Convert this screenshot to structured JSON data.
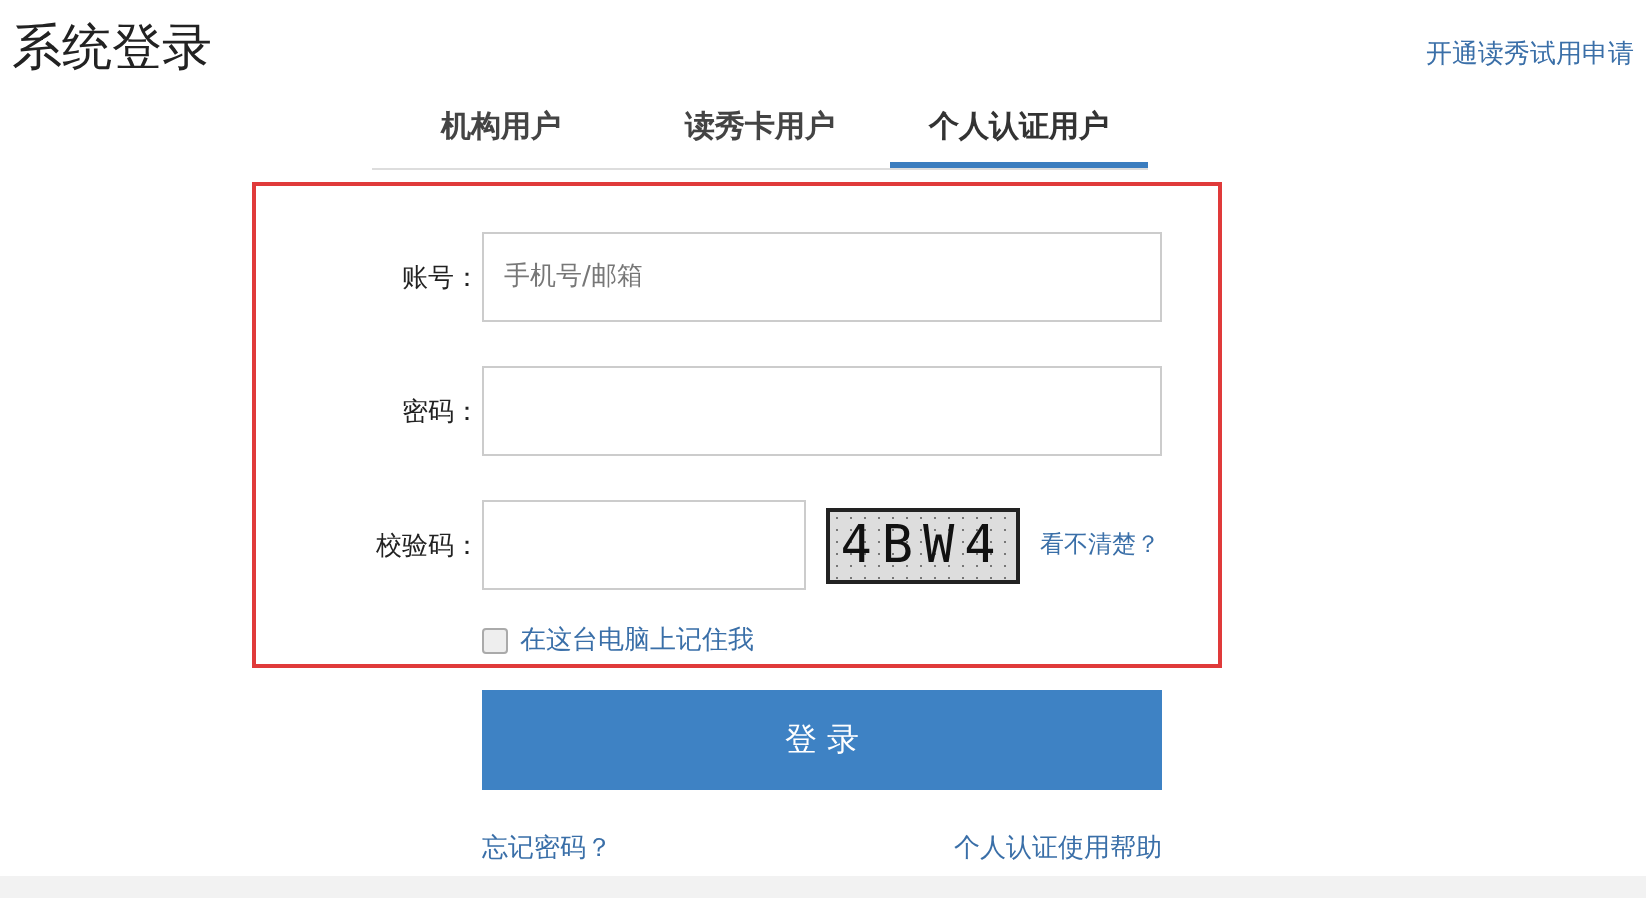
{
  "page_title": "系统登录",
  "trial_link": "开通读秀试用申请",
  "tabs": [
    {
      "label": "机构用户",
      "selected": false
    },
    {
      "label": "读秀卡用户",
      "selected": false
    },
    {
      "label": "个人认证用户",
      "selected": true
    }
  ],
  "form": {
    "fields": [
      {
        "kind": "text",
        "label": "账号：",
        "placeholder": "手机号/邮箱"
      },
      {
        "kind": "password",
        "label": "密码："
      },
      {
        "kind": "captcha",
        "label": "校验码：",
        "code": "4BW4",
        "refresh_link": "看不清楚？"
      }
    ],
    "remember": {
      "label": "在这台电脑上记住我",
      "checked": false
    }
  },
  "login_button": "登 录",
  "links": [
    "忘记密码？",
    "个人认证使用帮助"
  ]
}
